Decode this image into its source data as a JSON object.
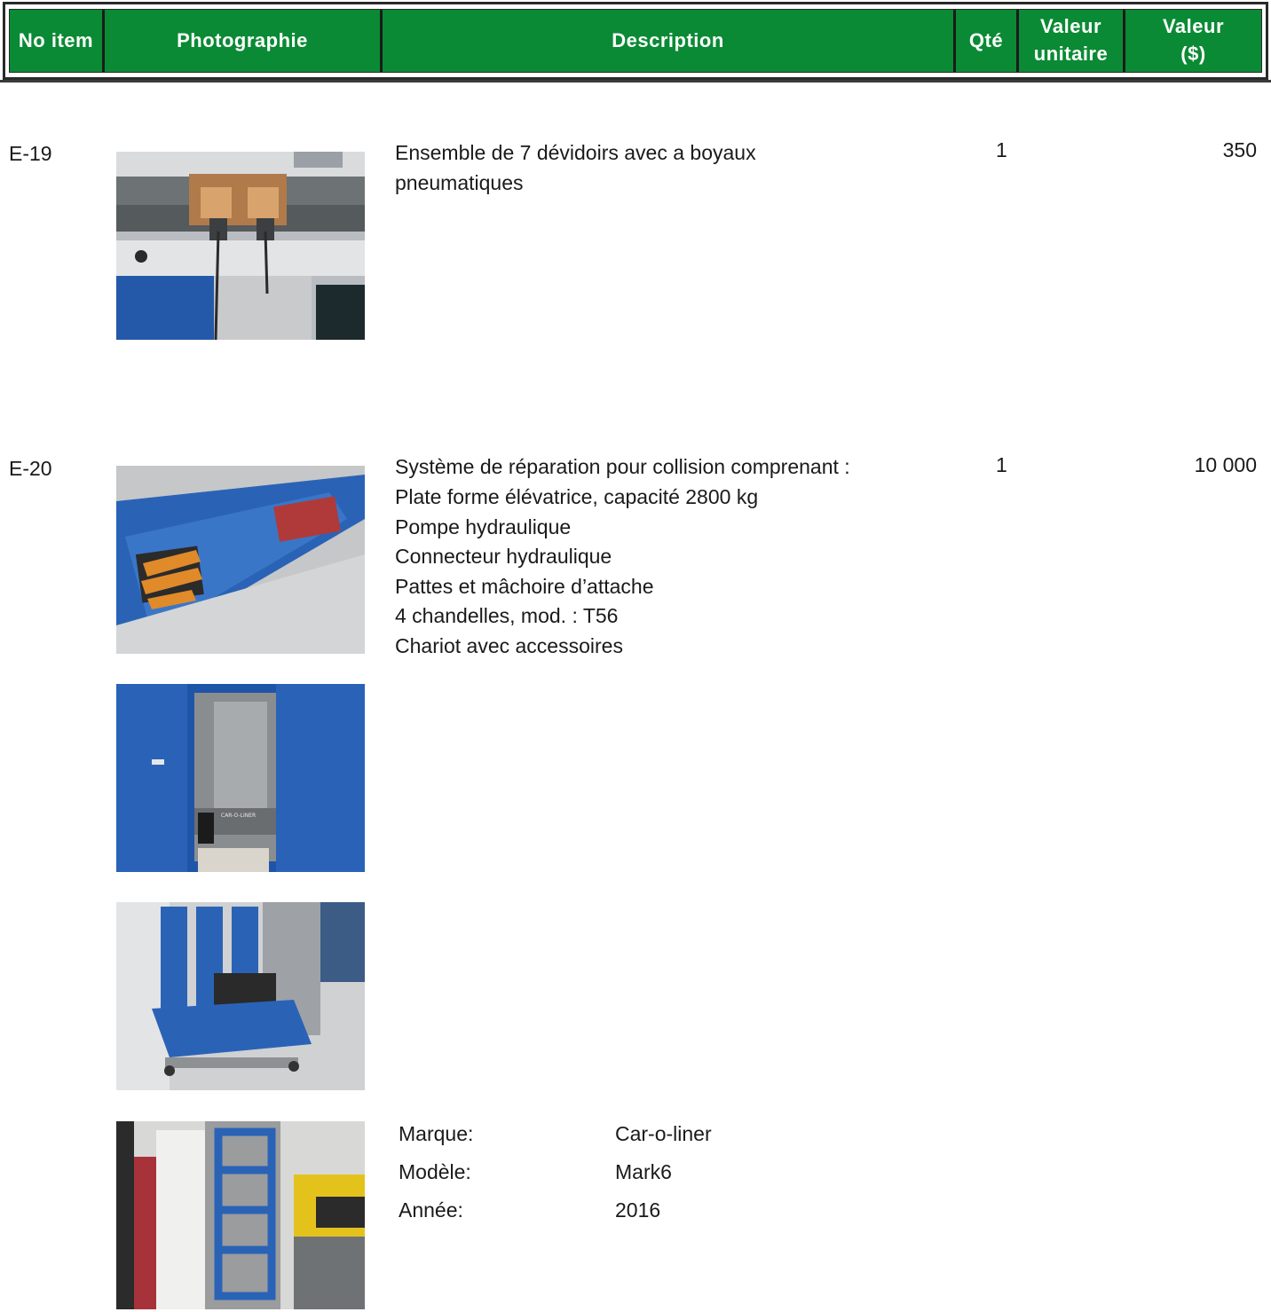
{
  "header": {
    "no_item": "No item",
    "photographie": "Photographie",
    "description": "Description",
    "qte": "Qté",
    "valeur_unitaire": "Valeur unitaire",
    "valeur": "Valeur ($)"
  },
  "items": [
    {
      "no": "E-19",
      "description_lines": [
        "Ensemble de 7 dévidoirs avec a boyaux",
        "pneumatiques"
      ],
      "qte": "1",
      "valeur": "350"
    },
    {
      "no": "E-20",
      "description_lines": [
        "Système de réparation pour collision comprenant :",
        "Plate forme élévatrice, capacité 2800 kg",
        "Pompe hydraulique",
        "Connecteur hydraulique",
        "Pattes et mâchoire d’attache",
        "4 chandelles, mod. : T56",
        "Chariot avec accessoires"
      ],
      "qte": "1",
      "valeur": "10 000",
      "specs": [
        {
          "label": "Marque:",
          "value": "Car-o-liner"
        },
        {
          "label": "Modèle:",
          "value": "Mark6"
        },
        {
          "label": "Année:",
          "value": "2016"
        }
      ],
      "photo_caption": "CAR-O-LINER"
    }
  ],
  "colors": {
    "header_green": "#0a8a34",
    "equipment_blue": "#1f5fb0"
  }
}
